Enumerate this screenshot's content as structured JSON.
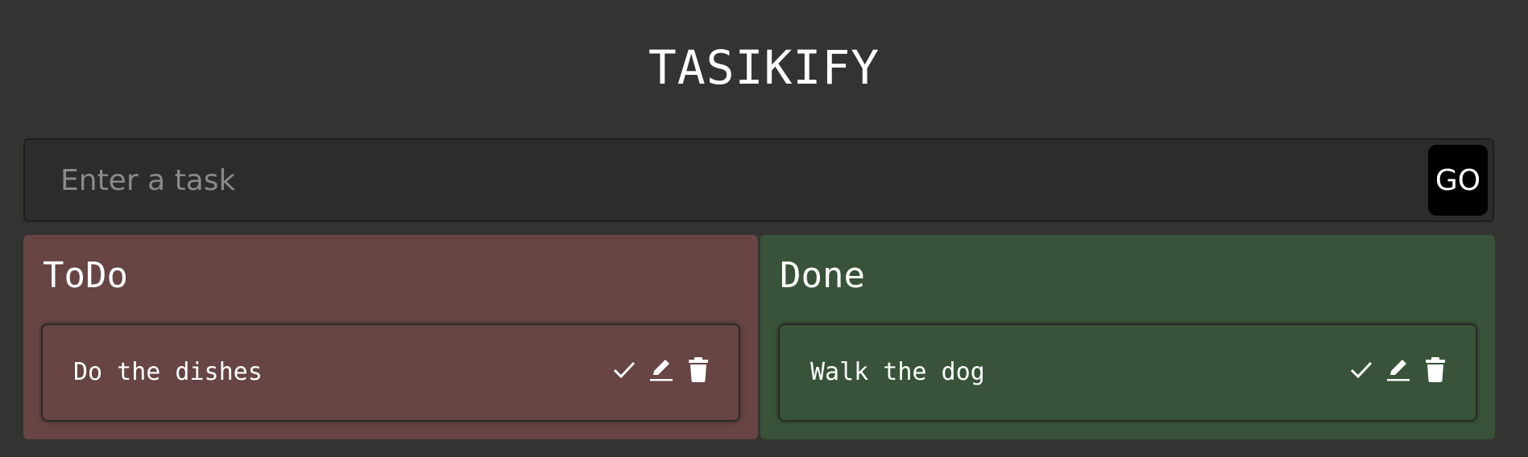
{
  "app": {
    "title": "TASIKIFY"
  },
  "form": {
    "placeholder": "Enter a task",
    "value": "",
    "submit_label": "GO"
  },
  "colors": {
    "background": "#333332",
    "todo_panel": "#664544",
    "done_panel": "#385339",
    "input_bg": "#2c2c2c",
    "button_bg": "#000000"
  },
  "columns": {
    "todo": {
      "title": "ToDo",
      "tasks": [
        {
          "text": "Do the dishes",
          "actions": [
            "check-icon",
            "edit-icon",
            "trash-icon"
          ]
        }
      ]
    },
    "done": {
      "title": "Done",
      "tasks": [
        {
          "text": "Walk the dog",
          "actions": [
            "check-icon",
            "edit-icon",
            "trash-icon"
          ]
        }
      ]
    }
  }
}
